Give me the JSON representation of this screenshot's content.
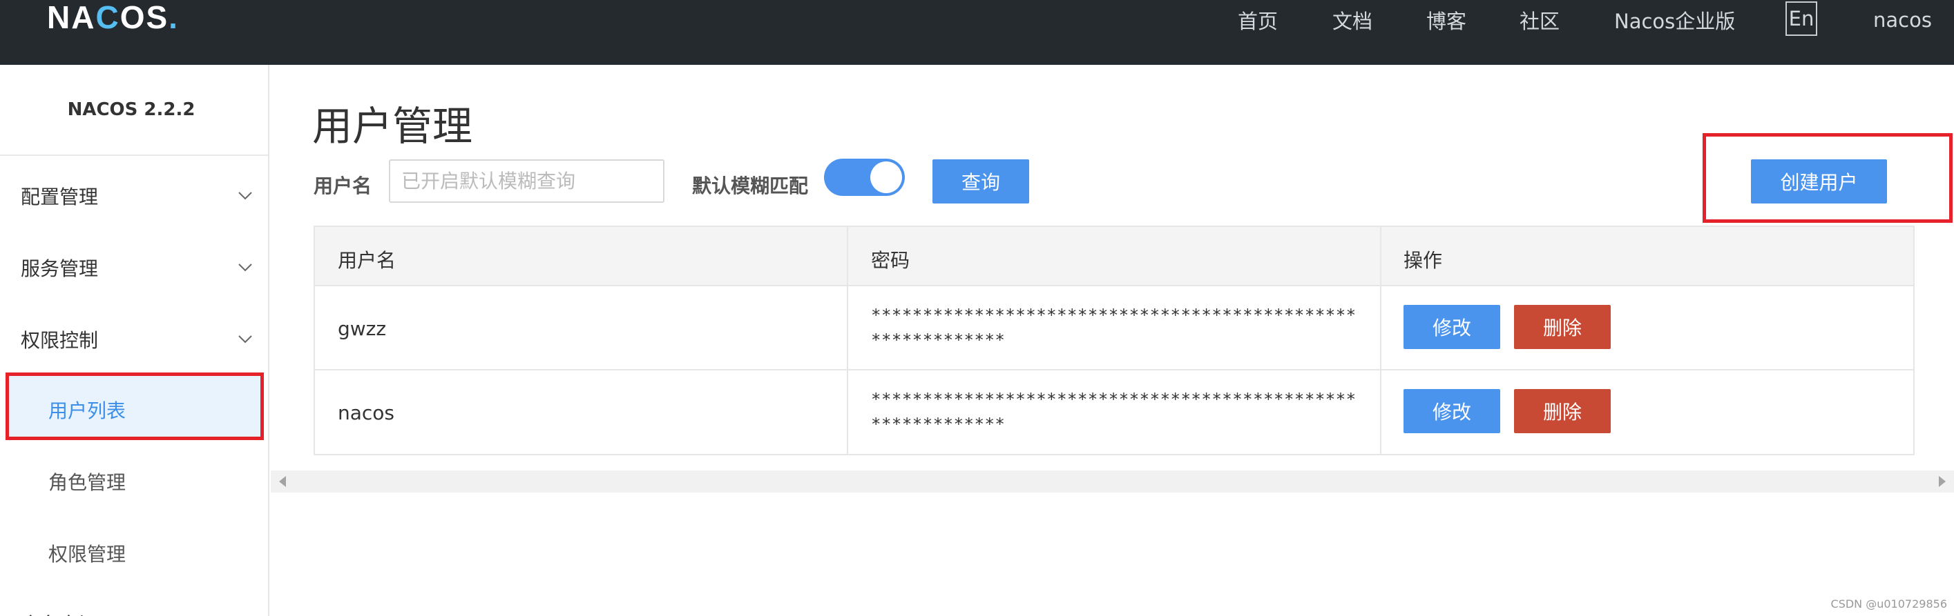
{
  "header": {
    "logo_pre": "NA",
    "logo_c": "C",
    "logo_post": "OS",
    "logo_dot": ".",
    "nav": [
      "首页",
      "文档",
      "博客",
      "社区",
      "Nacos企业版"
    ],
    "lang": "En",
    "user": "nacos"
  },
  "sidebar": {
    "version": "NACOS 2.2.2",
    "groups": [
      {
        "label": "配置管理"
      },
      {
        "label": "服务管理"
      },
      {
        "label": "权限控制"
      }
    ],
    "sub_items": [
      {
        "label": "用户列表"
      },
      {
        "label": "角色管理"
      },
      {
        "label": "权限管理"
      }
    ],
    "cut_off_label": "命名空间"
  },
  "main": {
    "title": "用户管理",
    "search": {
      "label": "用户名",
      "placeholder": "已开启默认模糊查询",
      "fuzzy_label": "默认模糊匹配",
      "fuzzy_on": true,
      "query_button": "查询"
    },
    "create_button": "创建用户",
    "table": {
      "columns": [
        "用户名",
        "密码",
        "操作"
      ],
      "rows": [
        {
          "username": "gwzz",
          "password": "************************************************************",
          "edit": "修改",
          "delete": "删除"
        },
        {
          "username": "nacos",
          "password": "************************************************************",
          "edit": "修改",
          "delete": "删除"
        }
      ]
    }
  },
  "watermark": "CSDN @u010729856",
  "colors": {
    "topbar": "#252a2f",
    "primary": "#4a94ee",
    "danger": "#c84934",
    "highlight": "#e5212a"
  }
}
